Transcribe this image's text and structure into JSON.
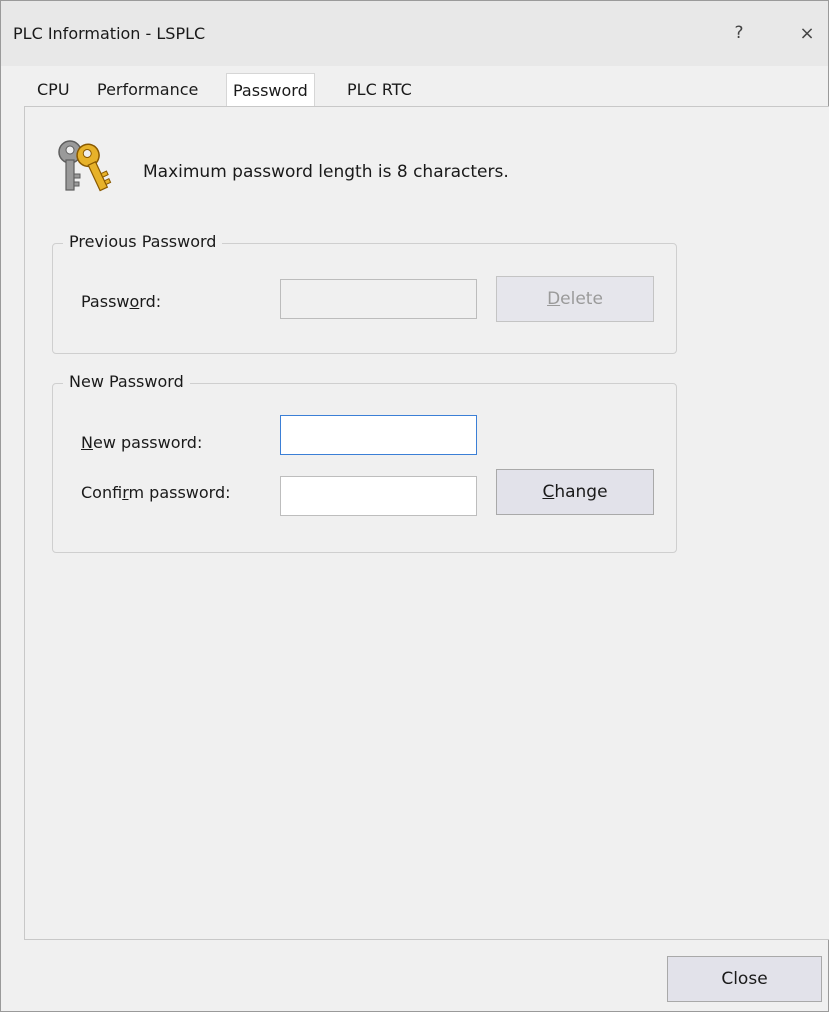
{
  "window": {
    "title": "PLC Information - LSPLC",
    "help_glyph": "?",
    "close_glyph": "×"
  },
  "tabs": [
    {
      "label": "CPU",
      "active": false
    },
    {
      "label": "Performance",
      "active": false
    },
    {
      "label": "Password",
      "active": true
    },
    {
      "label": "PLC RTC",
      "active": false
    }
  ],
  "info": {
    "icon": "keys-icon",
    "text": "Maximum password length is 8 characters."
  },
  "previous_password": {
    "legend": "Previous Password",
    "password_label_pre": "Passw",
    "password_label_mnemonic": "o",
    "password_label_post": "rd:",
    "password_value": "",
    "delete_mnemonic": "D",
    "delete_rest": "elete"
  },
  "new_password": {
    "legend": "New Password",
    "new_label_mnemonic": "N",
    "new_label_rest": "ew password:",
    "new_value": "",
    "confirm_label_pre": "Confi",
    "confirm_label_mnemonic": "r",
    "confirm_label_post": "m password:",
    "confirm_value": "",
    "change_mnemonic": "C",
    "change_rest": "hange"
  },
  "footer": {
    "close_label": "Close"
  },
  "colors": {
    "focus_border": "#3b7fd6",
    "key_gold": "#e2a81c",
    "key_gray": "#8d8d8d"
  }
}
